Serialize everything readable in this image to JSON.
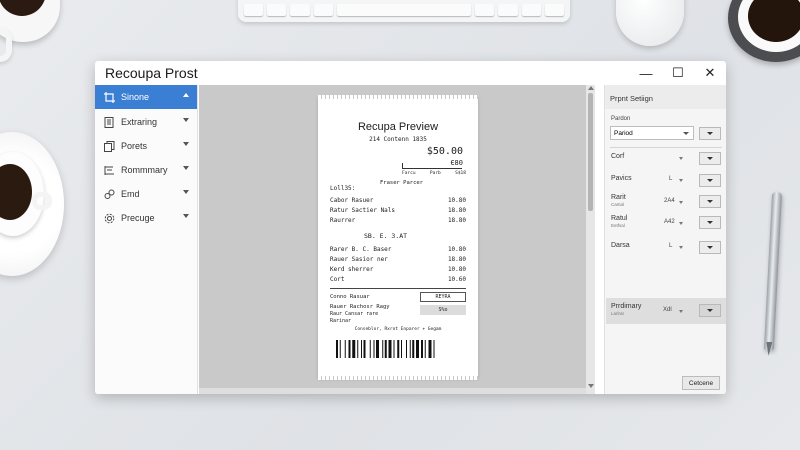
{
  "window": {
    "title": "Recoupa Prost",
    "controls": {
      "minimize": "—",
      "maximize": "☐",
      "close": "✕"
    }
  },
  "sidebar": {
    "items": [
      {
        "label": "Sinone",
        "icon": "crop-icon",
        "active": true
      },
      {
        "label": "Extraring",
        "icon": "document-icon",
        "active": false
      },
      {
        "label": "Porets",
        "icon": "copy-icon",
        "active": false
      },
      {
        "label": "Rommmary",
        "icon": "ruler-icon",
        "active": false
      },
      {
        "label": "Emd",
        "icon": "link-icon",
        "active": false
      },
      {
        "label": "Precuge",
        "icon": "gear-icon",
        "active": false
      }
    ]
  },
  "receipt": {
    "title": "Recupa Preview",
    "subtitle": "214 Contenn 1835",
    "total_big": "$50.00",
    "total_small": "Є80",
    "small_row": [
      "Farcu",
      "Parb",
      "S$18"
    ],
    "code": "Loll35:",
    "header_label": "Fraser Parcer",
    "rows_group1": [
      {
        "name": "Cabor Rasuer",
        "value": "10.80"
      },
      {
        "name": "Ratur Sactier Nals",
        "value": "18.80"
      },
      {
        "name": "Raurrer",
        "value": "18.80"
      }
    ],
    "center_text": "SB. E. 3.AT",
    "rows_group2": [
      {
        "name": "Rarer    B. C. Baser",
        "value": "10.80"
      },
      {
        "name": "Rauer Sasior ner",
        "value": "18.80"
      },
      {
        "name": "Kerd sherrer",
        "value": "10.80"
      },
      {
        "name": "Cort",
        "value": "10.60"
      }
    ],
    "box_rows": [
      {
        "name": "Conno Rasuar",
        "box": "REYRA"
      },
      {
        "name": "Rauer Rachosr Ragy",
        "box": "S%o"
      }
    ],
    "small_lines": [
      "Raur Cansar rare",
      "Rarinar"
    ],
    "footer": "Conseblor, Rxrot Enparer + Gegam"
  },
  "settings": {
    "title": "Prpnt Setiign",
    "label_top": "Pardon",
    "select_value": "Pariod",
    "rows": [
      {
        "label": "Corf",
        "sub": "",
        "value": "",
        "has_mini_dd": true
      },
      {
        "label": "Pavics",
        "sub": "",
        "value": "L",
        "has_mini_dd": true
      },
      {
        "label": "Rarit",
        "sub": "Cartial",
        "value": "2A4",
        "has_mini_dd": true
      },
      {
        "label": "Ratul",
        "sub": "Eetfsal",
        "value": "A42",
        "has_mini_dd": true
      },
      {
        "label": "Darsa",
        "sub": "",
        "value": "L",
        "has_mini_dd": true
      },
      {
        "label": "Prrdimary",
        "sub": "Larlrat",
        "value": "Xdl",
        "has_mini_dd": true
      }
    ],
    "cancel_label": "Cetcene"
  }
}
